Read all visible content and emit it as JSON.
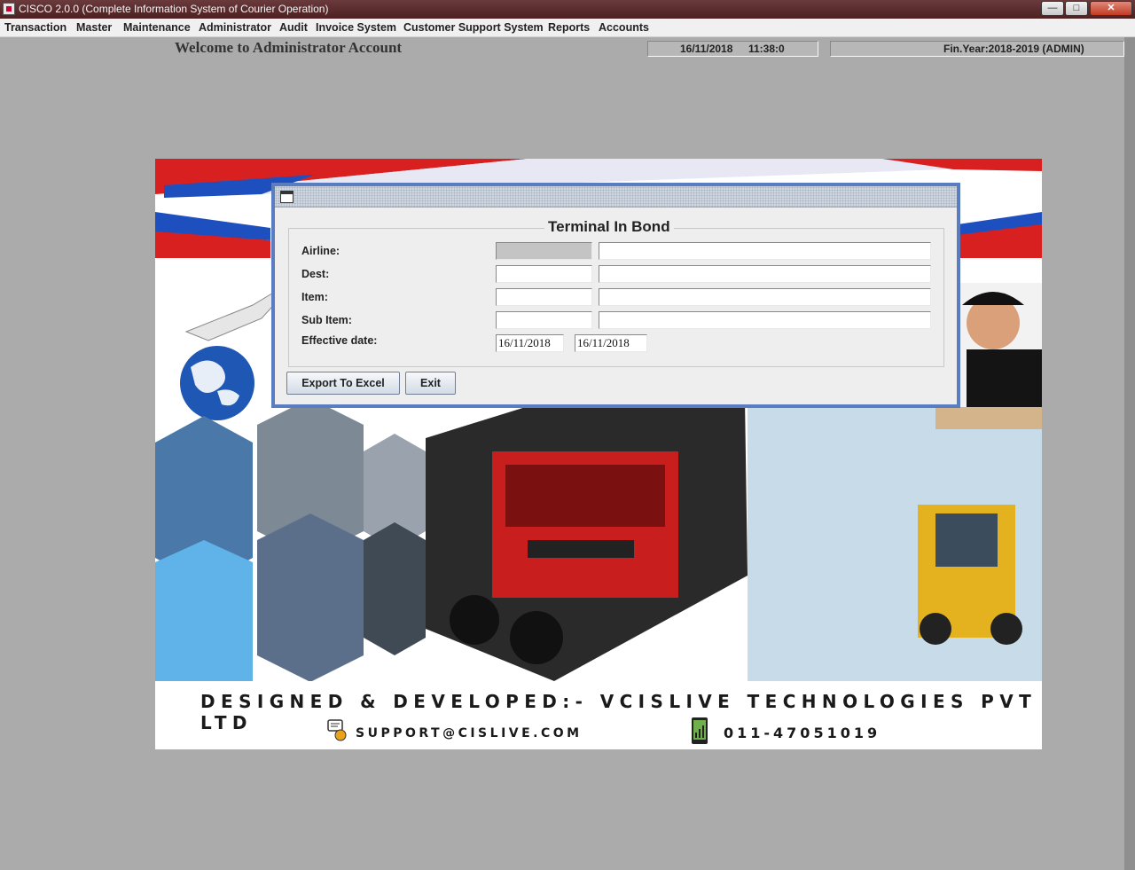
{
  "window": {
    "title": "CISCO 2.0.0 (Complete Information System of Courier Operation)",
    "minimize": "—",
    "maximize": "□",
    "close": "✕"
  },
  "menu": [
    {
      "label": "Transaction"
    },
    {
      "label": "Master"
    },
    {
      "label": "Maintenance"
    },
    {
      "label": "Administrator"
    },
    {
      "label": "Audit"
    },
    {
      "label": "Invoice System"
    },
    {
      "label": "Customer Support System"
    },
    {
      "label": "Reports"
    },
    {
      "label": "Accounts"
    }
  ],
  "header": {
    "welcome": "Welcome to Administrator Account",
    "date": "16/11/2018",
    "time": "11:38:0",
    "fin_year": "Fin.Year:2018-2019  (ADMIN)"
  },
  "splash": {
    "developer": "DESIGNED & DEVELOPED:- VCISLIVE TECHNOLOGIES PVT LTD",
    "email": "SUPPORT@CISLIVE.COM",
    "phone": "011-47051019"
  },
  "dialog": {
    "title": "Terminal In Bond",
    "labels": {
      "airline": "Airline:",
      "dest": "Dest:",
      "item": "Item:",
      "sub_item": "Sub Item:",
      "effective_date": "Effective date:"
    },
    "values": {
      "airline_code": "",
      "airline_name": "",
      "dest_code": "",
      "dest_name": "",
      "item_code": "",
      "item_name": "",
      "sub_item_code": "",
      "sub_item_name": "",
      "date_from": "16/11/2018",
      "date_to": "16/11/2018"
    },
    "buttons": {
      "export": "Export To Excel",
      "exit": "Exit"
    }
  },
  "colors": {
    "titlebar": "#5a2a2c",
    "dialog_border": "#5a7dc2",
    "desktop": "#ababab"
  }
}
